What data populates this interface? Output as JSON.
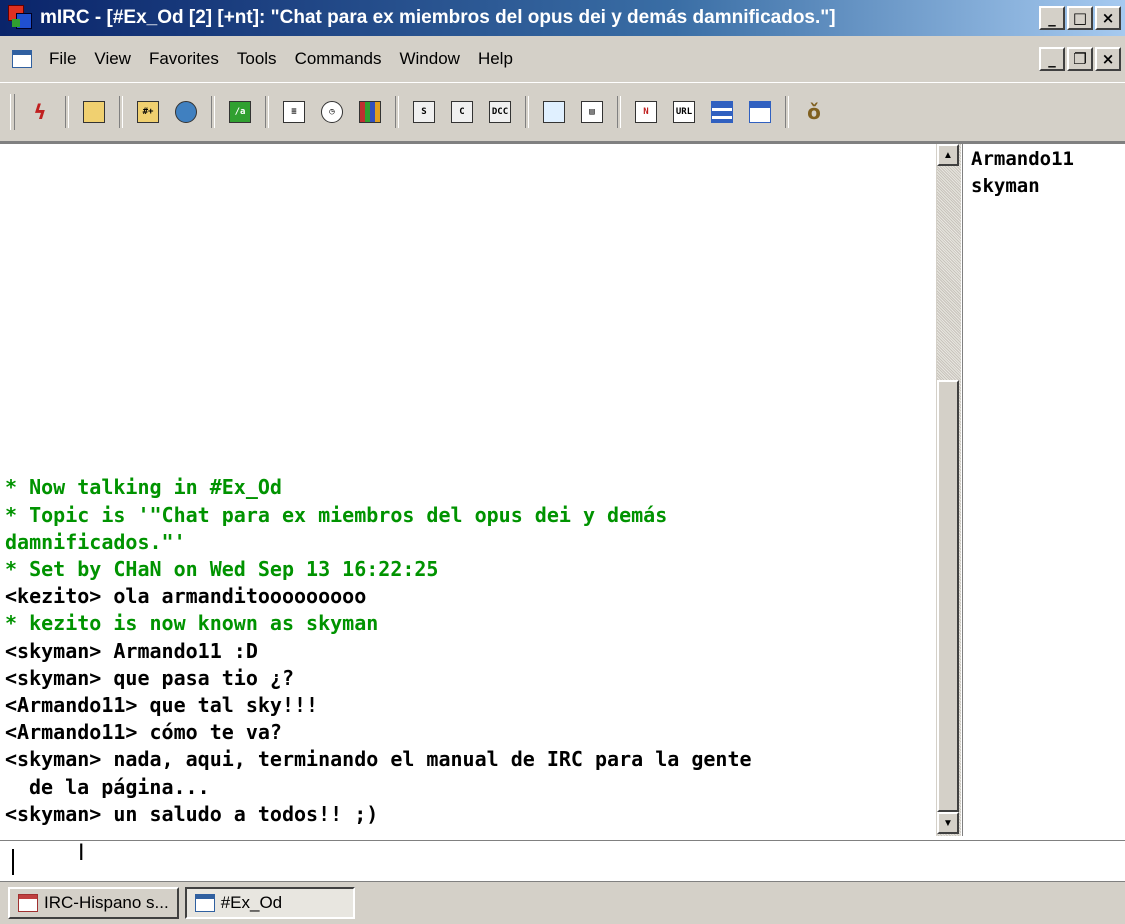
{
  "window": {
    "title": "mIRC - [#Ex_Od [2] [+nt]: \"Chat para ex miembros del opus dei y demás damnificados.\"]",
    "buttons": [
      "_",
      "□",
      "×"
    ],
    "mdi_buttons": [
      "_",
      "❐",
      "×"
    ]
  },
  "menubar": {
    "items": [
      "File",
      "View",
      "Favorites",
      "Tools",
      "Commands",
      "Window",
      "Help"
    ]
  },
  "toolbar": {
    "icons": [
      "connect-icon",
      "options-icon",
      "channels-folder-icon",
      "server-list-icon",
      "scripts-editor-icon",
      "address-book-icon",
      "timer-icon",
      "colors-icon",
      "send-file-icon",
      "chat-icon",
      "dcc-options-icon",
      "received-files-icon",
      "log-files-icon",
      "notify-list-icon",
      "url-list-icon",
      "tile-horizontal-icon",
      "cascade-icon",
      "help-icon"
    ]
  },
  "chat": {
    "lines": [
      {
        "text": "* Now talking in #Ex_Od",
        "type": "sys"
      },
      {
        "text": "* Topic is '\"Chat para ex miembros del opus dei y demás",
        "type": "sys"
      },
      {
        "text": "damnificados.\"'",
        "type": "sys"
      },
      {
        "text": "* Set by CHaN on Wed Sep 13 16:22:25",
        "type": "sys"
      },
      {
        "text": "<kezito> ola armanditooooooooo",
        "type": "msg"
      },
      {
        "text": "* kezito is now known as skyman",
        "type": "sys"
      },
      {
        "text": "<skyman> Armando11 :D",
        "type": "msg"
      },
      {
        "text": "<skyman> que pasa tio ¿?",
        "type": "msg"
      },
      {
        "text": "<Armando11> que tal sky!!!",
        "type": "msg"
      },
      {
        "text": "<Armando11> cómo te va?",
        "type": "msg"
      },
      {
        "text": "<skyman> nada, aqui, terminando el manual de IRC para la gente",
        "type": "msg"
      },
      {
        "text": "de la página...",
        "type": "msg indent"
      },
      {
        "text": "<skyman> un saludo a todos!! ;)",
        "type": "msg"
      }
    ]
  },
  "nicklist": [
    "Armando11",
    "skyman"
  ],
  "input": {
    "value": ""
  },
  "switchbar": {
    "items": [
      {
        "label": "IRC-Hispano s...",
        "icon": "status-window-icon",
        "active": false
      },
      {
        "label": "#Ex_Od",
        "icon": "channel-window-icon",
        "active": true
      }
    ]
  },
  "colors": {
    "system_message": "#009300",
    "titlebar": "#0a246a"
  }
}
